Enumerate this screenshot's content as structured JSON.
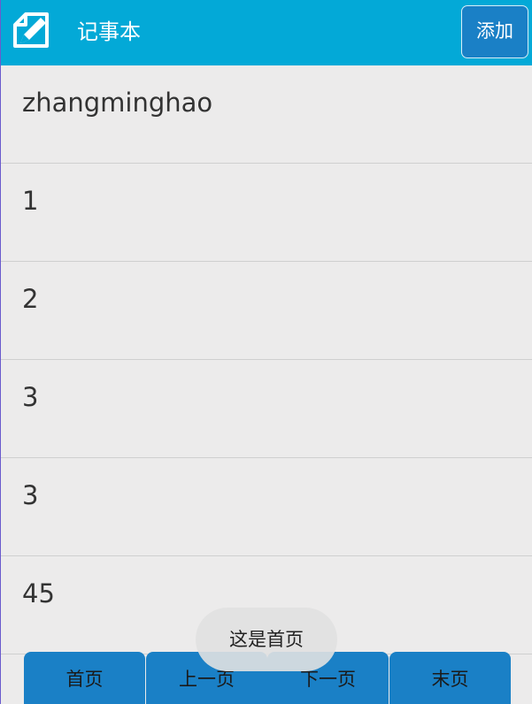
{
  "header": {
    "title": "记事本",
    "add_label": "添加",
    "icon": "notepad-edit-icon",
    "background_color": "#03a9d7"
  },
  "notes": [
    {
      "label": "zhangminghao"
    },
    {
      "label": "1"
    },
    {
      "label": "2"
    },
    {
      "label": "3"
    },
    {
      "label": "3"
    },
    {
      "label": "45"
    }
  ],
  "pager": {
    "first_label": "首页",
    "prev_label": "上一页",
    "next_label": "下一页",
    "last_label": "末页",
    "button_color": "#1a80c6"
  },
  "toast": {
    "message": "这是首页"
  }
}
